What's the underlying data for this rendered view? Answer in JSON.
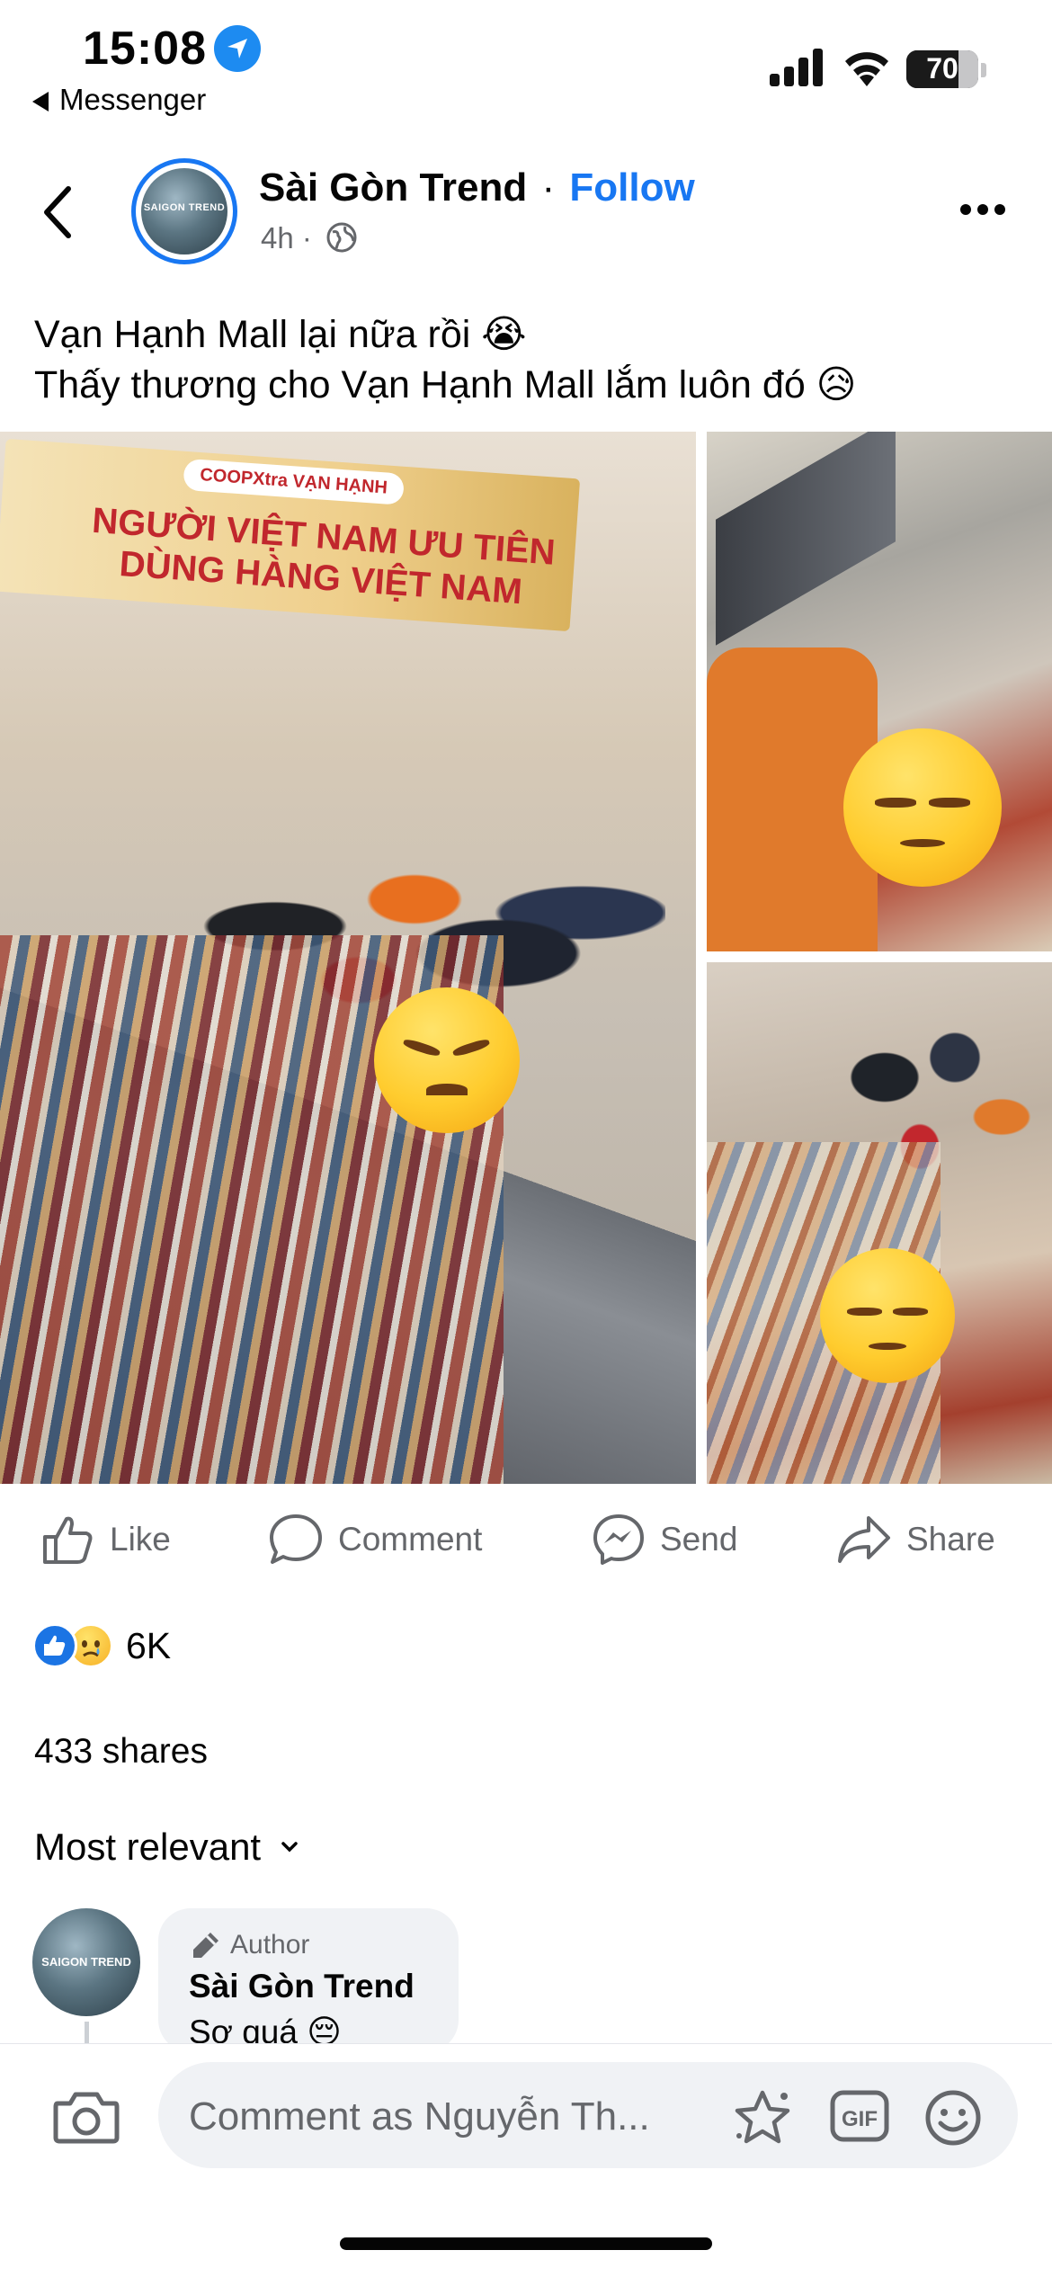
{
  "status_bar": {
    "time": "15:08",
    "back_app": "Messenger",
    "battery": "70"
  },
  "post": {
    "page_name": "Sài Gòn Trend",
    "separator": "·",
    "follow_label": "Follow",
    "time_ago": "4h ·",
    "avatar_text": "SAIGON TREND",
    "caption_line1": "Vạn Hạnh Mall lại nữa rồi 😭",
    "caption_line2": "Thấy thương cho Vạn Hạnh Mall lắm luôn đó 😥",
    "banner_logo": "COOPXtra VẠN HẠNH",
    "banner_line1": "NGƯỜI VIỆT NAM ƯU TIÊN",
    "banner_line2": "DÙNG HÀNG VIỆT NAM"
  },
  "actions": {
    "like": "Like",
    "comment": "Comment",
    "send": "Send",
    "share": "Share"
  },
  "reactions": {
    "count": "6K",
    "shares": "433 shares"
  },
  "comments": {
    "sort_label": "Most relevant",
    "first": {
      "author_tag": "Author",
      "name": "Sài Gòn Trend",
      "text": "Sợ quá 😔",
      "avatar_text": "SAIGON TREND"
    }
  },
  "composer": {
    "placeholder": "Comment as Nguyễn Th..."
  },
  "colors": {
    "accent": "#1877f2",
    "secondary_text": "#65676b",
    "bubble_bg": "#f0f2f5"
  }
}
